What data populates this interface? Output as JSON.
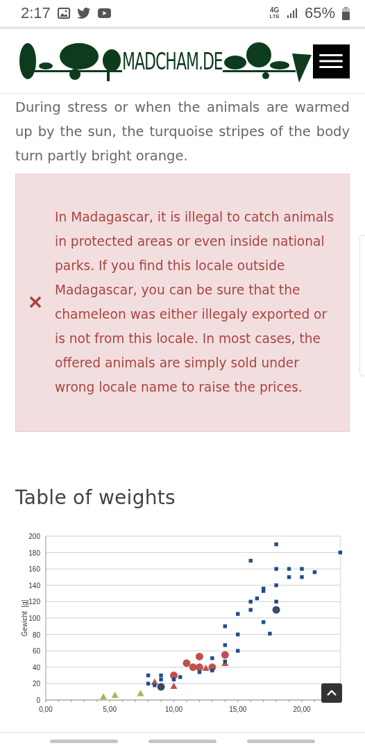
{
  "status_bar": {
    "time": "2:17",
    "network": "4G",
    "network_sub": "LTE",
    "battery": "65%"
  },
  "header": {
    "logo_text": "MADCHAM.DE"
  },
  "intro_paragraph": "During stress or when the animals are warmed up by the sun, the turquoise stripes of the body turn partly bright orange.",
  "alert": {
    "text": "In Madagascar, it is illegal to catch animals in protected areas or even inside national parks. If you find this locale outside Madagascar, you can be sure that the chameleon was either illegaly exported or is not from this locale. In most cases, the offered animals are simply sold under wrong locale name to raise the prices."
  },
  "section_heading": "Table of weights",
  "chart_data": {
    "type": "scatter",
    "grid": true,
    "ylabel": "Gewicht  [g]",
    "xlim": [
      0,
      23
    ],
    "ylim": [
      0,
      200
    ],
    "xticks": [
      {
        "value": 0,
        "label": "0,00"
      },
      {
        "value": 5,
        "label": "5,00"
      },
      {
        "value": 10,
        "label": "10,00"
      },
      {
        "value": 15,
        "label": "15,00"
      },
      {
        "value": 20,
        "label": "20,00"
      }
    ],
    "yticks": [
      0,
      20,
      40,
      60,
      80,
      100,
      120,
      140,
      160,
      180,
      200
    ],
    "series": [
      {
        "color": "#1f4e8c",
        "x": [
          8,
          8,
          8.5,
          9,
          9,
          10,
          10.5,
          12,
          13,
          13,
          14,
          14,
          14,
          15,
          15,
          15,
          16,
          16,
          16,
          16.5,
          17,
          17,
          17,
          17.5,
          18,
          18,
          18,
          18,
          19,
          19,
          20,
          20,
          21,
          23
        ],
        "values": [
          30,
          20,
          18,
          30,
          25,
          25,
          28,
          34,
          51,
          36,
          90,
          67,
          47,
          105,
          80,
          60,
          170,
          120,
          110,
          124,
          136,
          133,
          95,
          81,
          190,
          160,
          140,
          120,
          160,
          150,
          160,
          150,
          156,
          180
        ]
      },
      {
        "color": "#c0504d",
        "x": [
          10,
          11,
          11.5,
          12,
          12,
          13,
          14
        ],
        "values": [
          30,
          45,
          40,
          53,
          40,
          40,
          55
        ]
      },
      {
        "color": "#c0504d",
        "x": [
          8.5,
          10,
          12.5,
          14
        ],
        "values": [
          22,
          17,
          39,
          45
        ]
      },
      {
        "color": "#3d4a66",
        "x": [
          9,
          18
        ],
        "values": [
          16,
          110
        ]
      },
      {
        "color": "#9bbb59",
        "x": [
          4.5,
          5.4,
          7.4
        ],
        "values": [
          4,
          6,
          8
        ]
      }
    ]
  }
}
